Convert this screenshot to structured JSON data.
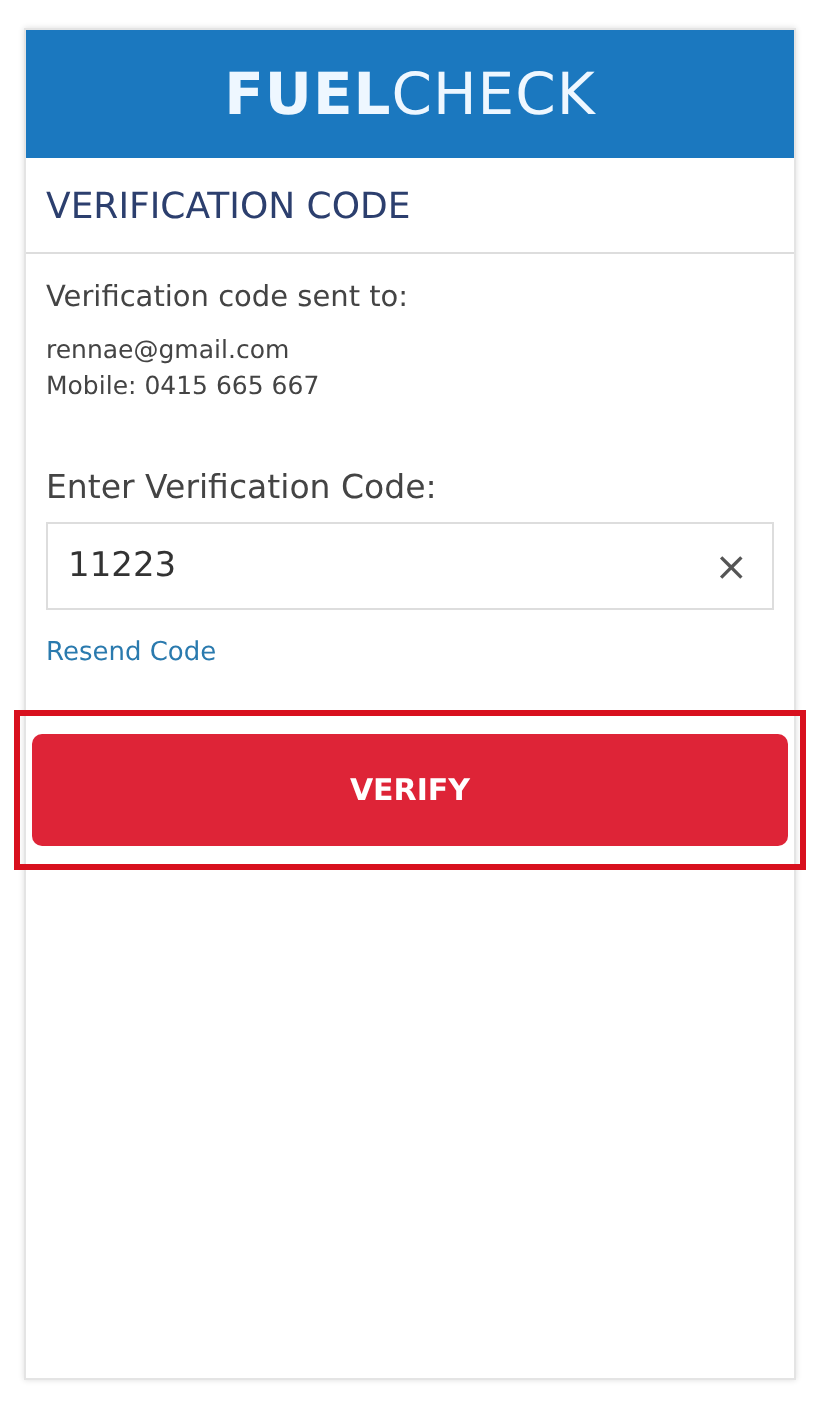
{
  "header": {
    "logo": "**FUEL**CHECK"
  },
  "section_title": "VERIFICATION CODE",
  "sent_to": {
    "label": "Verification code sent to:",
    "lines": [
      "rennae@gmail.com",
      "Mobile: 0415 665 667"
    ]
  },
  "code_field": {
    "label": "Enter Verification Code:",
    "value": "11223",
    "clear": "×"
  },
  "resend_link": "Resend Code",
  "verify_button": {
    "label": "VERIFY",
    "highlighted": true
  }
}
